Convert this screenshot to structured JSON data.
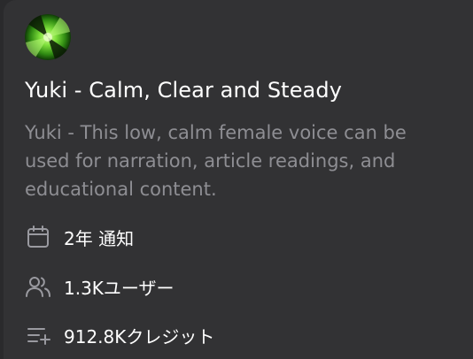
{
  "voice_card": {
    "title": "Yuki - Calm, Clear and Steady",
    "description": "Yuki - This low, calm female voice can be used for narration, article readings, and educational content.",
    "avatar_icon": "green-swirl-avatar",
    "meta": {
      "age": "2年 通知",
      "users": "1.3Kユーザー",
      "credits": "912.8Kクレジット"
    },
    "icons": {
      "age": "calendar-icon",
      "users": "users-icon",
      "credits": "playlist-add-icon"
    }
  },
  "colors": {
    "card_background": "#323234",
    "title": "#ffffff",
    "description": "#8e8e93",
    "icon": "#9a9aa0",
    "avatar_green": "#6fd23a"
  }
}
